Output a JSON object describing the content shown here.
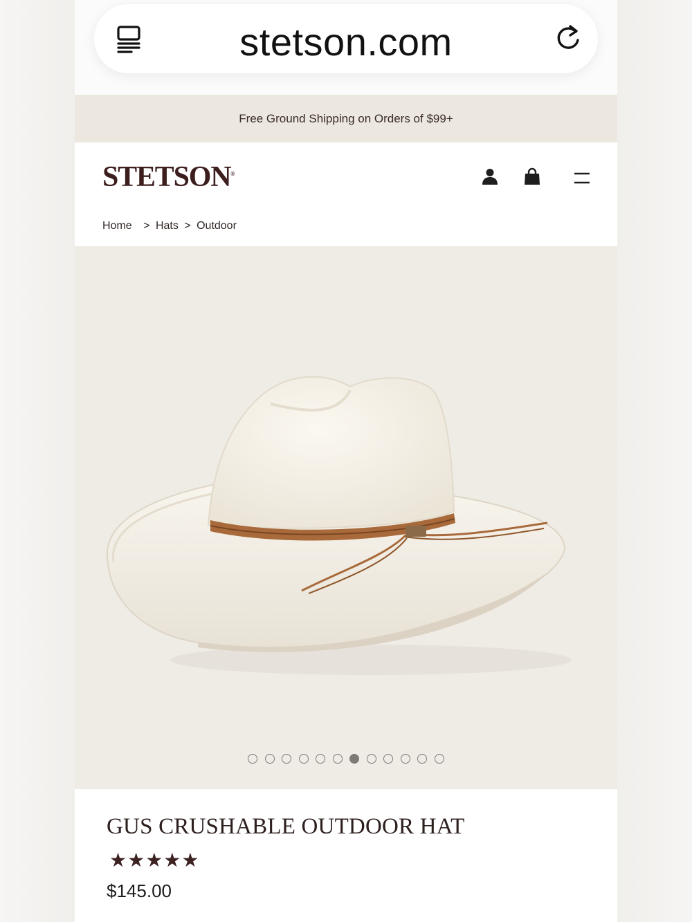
{
  "browser": {
    "url": "stetson.com",
    "tabs_icon": "tabs-icon",
    "reload_icon": "reload-icon"
  },
  "promo": {
    "text": "Free Ground Shipping on Orders of $99+"
  },
  "header": {
    "logo": "STETSON",
    "logo_mark": "®",
    "icons": [
      "account-icon",
      "bag-icon",
      "menu-icon"
    ]
  },
  "breadcrumb": {
    "items": [
      "Home",
      "Hats",
      "Outdoor"
    ],
    "separators": [
      ">",
      ">"
    ]
  },
  "gallery": {
    "image_count": 12,
    "active_index": 6
  },
  "product": {
    "title": "GUS CRUSHABLE OUTDOOR HAT",
    "stars": "★★★★★",
    "rating": 5,
    "price": "$145.00"
  },
  "colors": {
    "brand": "#3d1e1e",
    "promo_bg": "#ece8e0",
    "gallery_bg": "#efece6"
  }
}
